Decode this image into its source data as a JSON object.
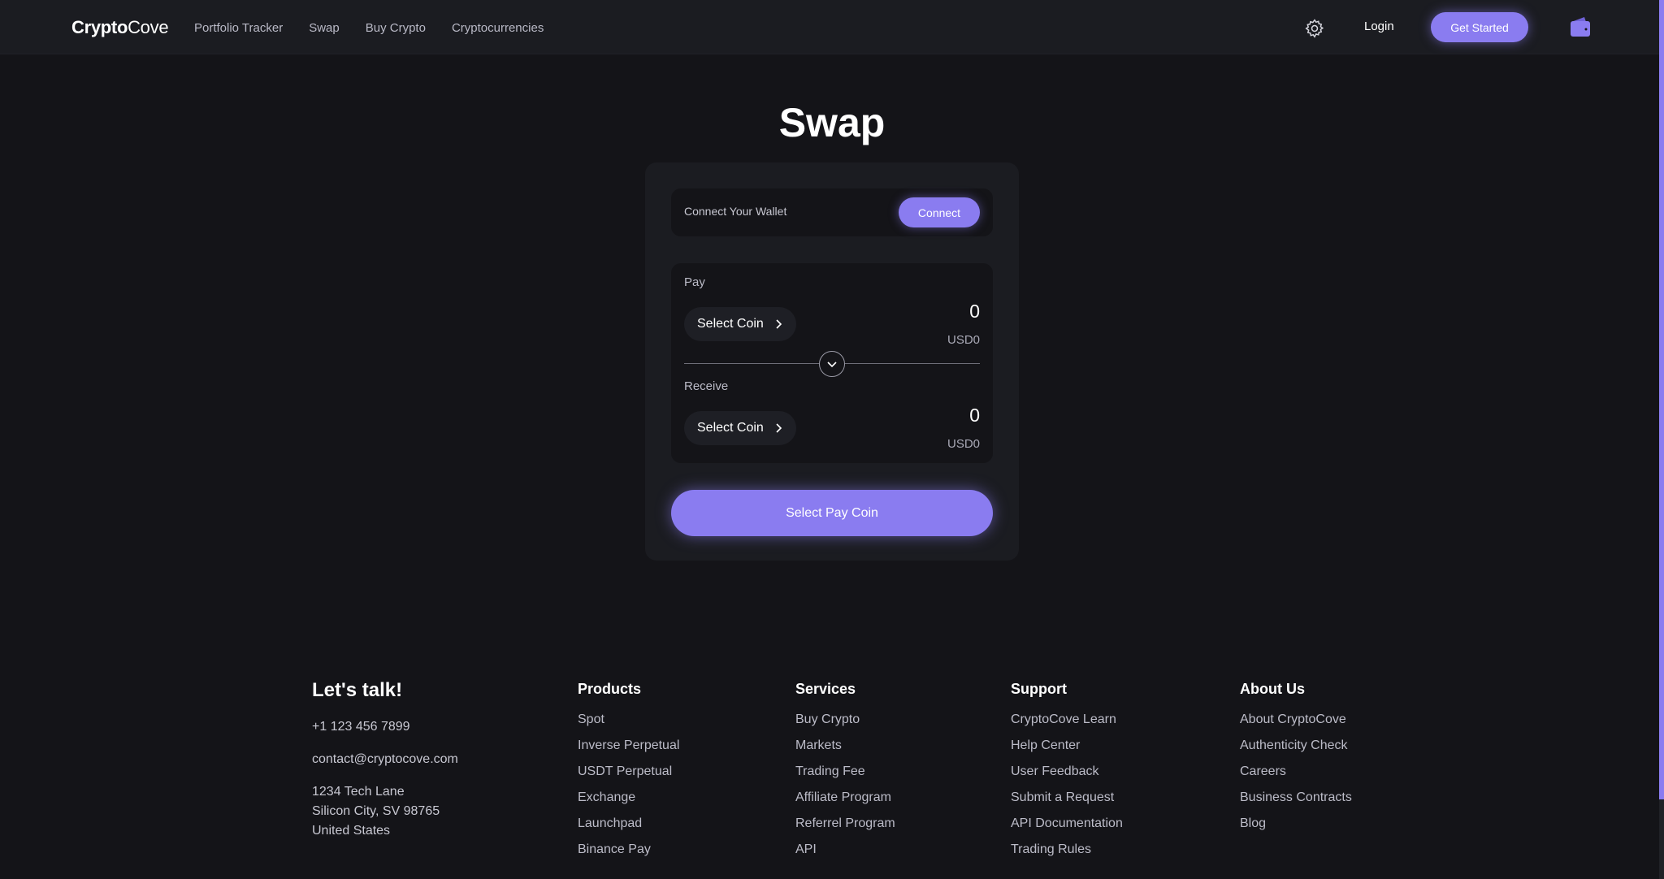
{
  "header": {
    "logo_bold": "Crypto",
    "logo_rest": "Cove",
    "nav": [
      "Portfolio Tracker",
      "Swap",
      "Buy Crypto",
      "Cryptocurrencies"
    ],
    "login": "Login",
    "get_started": "Get Started"
  },
  "swap": {
    "title": "Swap",
    "connect_label": "Connect Your Wallet",
    "connect_button": "Connect",
    "pay_label": "Pay",
    "pay_coin": "Select Coin",
    "pay_amount": "0",
    "pay_usd": "USD0",
    "receive_label": "Receive",
    "receive_coin": "Select Coin",
    "receive_amount": "0",
    "receive_usd": "USD0",
    "submit": "Select Pay Coin"
  },
  "footer": {
    "talk_title": "Let's talk!",
    "phone": "+1 123 456 7899",
    "email": "contact@cryptocove.com",
    "address1": "1234 Tech Lane",
    "address2": "Silicon City, SV 98765",
    "address3": "United States",
    "columns": [
      {
        "title": "Products",
        "items": [
          "Spot",
          "Inverse Perpetual",
          "USDT Perpetual",
          "Exchange",
          "Launchpad",
          "Binance Pay"
        ]
      },
      {
        "title": "Services",
        "items": [
          "Buy Crypto",
          "Markets",
          "Trading Fee",
          "Affiliate Program",
          "Referrel Program",
          "API"
        ]
      },
      {
        "title": "Support",
        "items": [
          "CryptoCove Learn",
          "Help Center",
          "User Feedback",
          "Submit a Request",
          "API Documentation",
          "Trading Rules"
        ]
      },
      {
        "title": "About Us",
        "items": [
          "About CryptoCove",
          "Authenticity Check",
          "Careers",
          "Business Contracts",
          "Blog"
        ]
      }
    ]
  },
  "colors": {
    "accent": "#8a7cf0",
    "background": "#141418",
    "card": "#1b1c21"
  },
  "icons": [
    "gear-icon",
    "wallet-icon",
    "chevron-right-icon",
    "chevron-down-icon"
  ]
}
